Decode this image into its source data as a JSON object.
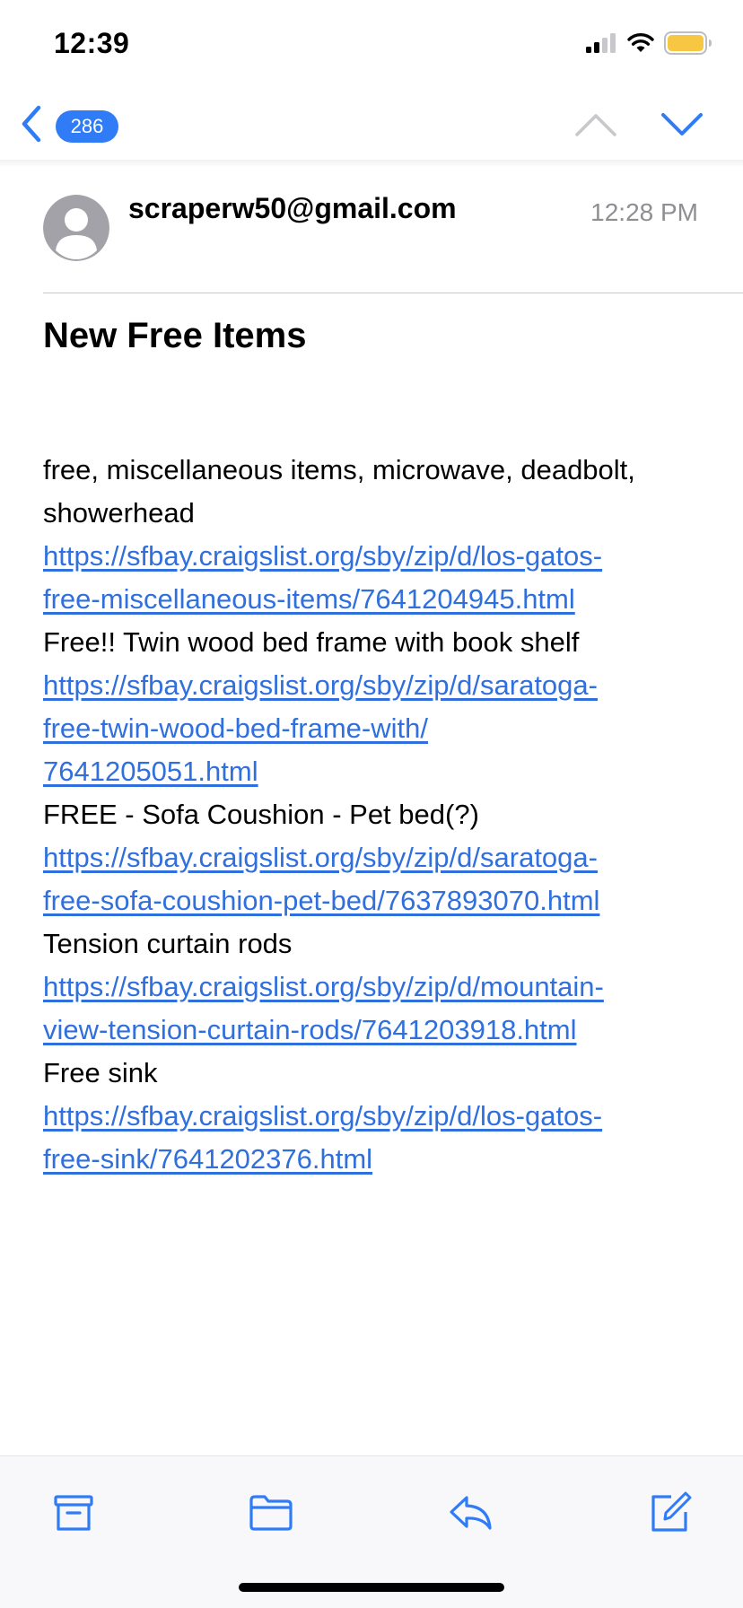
{
  "status_bar": {
    "time": "12:39",
    "icons": [
      "cellular-signal-icon",
      "wifi-icon",
      "battery-icon"
    ],
    "battery_color": "#f7c744"
  },
  "nav": {
    "unread_count": "286",
    "accent_color": "#2f7cf6",
    "icons": [
      "back-chevron-icon",
      "previous-message-icon",
      "next-message-icon"
    ]
  },
  "message": {
    "sender": "scraperw50@gmail.com",
    "time": "12:28 PM",
    "subject": "New Free Items",
    "body": [
      {
        "type": "text",
        "text": "free, miscellaneous items, microwave, deadbolt,"
      },
      {
        "type": "text",
        "text": "showerhead"
      },
      {
        "type": "link",
        "text": "https://sfbay.craigslist.org/sby/zip/d/los-gatos-"
      },
      {
        "type": "link",
        "text": "free-miscellaneous-items/7641204945.html"
      },
      {
        "type": "text",
        "text": "Free!! Twin  wood bed frame with book shelf"
      },
      {
        "type": "link",
        "text": "https://sfbay.craigslist.org/sby/zip/d/saratoga-"
      },
      {
        "type": "link",
        "text": "free-twin-wood-bed-frame-with/"
      },
      {
        "type": "link",
        "text": "7641205051.html"
      },
      {
        "type": "text",
        "text": "FREE - Sofa Coushion - Pet bed(?)"
      },
      {
        "type": "link",
        "text": "https://sfbay.craigslist.org/sby/zip/d/saratoga-"
      },
      {
        "type": "link",
        "text": "free-sofa-coushion-pet-bed/7637893070.html"
      },
      {
        "type": "text",
        "text": "Tension curtain rods"
      },
      {
        "type": "link",
        "text": "https://sfbay.craigslist.org/sby/zip/d/mountain-"
      },
      {
        "type": "link",
        "text": "view-tension-curtain-rods/7641203918.html"
      },
      {
        "type": "text",
        "text": "Free sink"
      },
      {
        "type": "link",
        "text": "https://sfbay.craigslist.org/sby/zip/d/los-gatos-"
      },
      {
        "type": "link",
        "text": "free-sink/7641202376.html"
      }
    ],
    "link_color": "#2f6fde"
  },
  "toolbar": {
    "icons": [
      "archive-icon",
      "folder-icon",
      "reply-icon",
      "compose-icon"
    ]
  }
}
